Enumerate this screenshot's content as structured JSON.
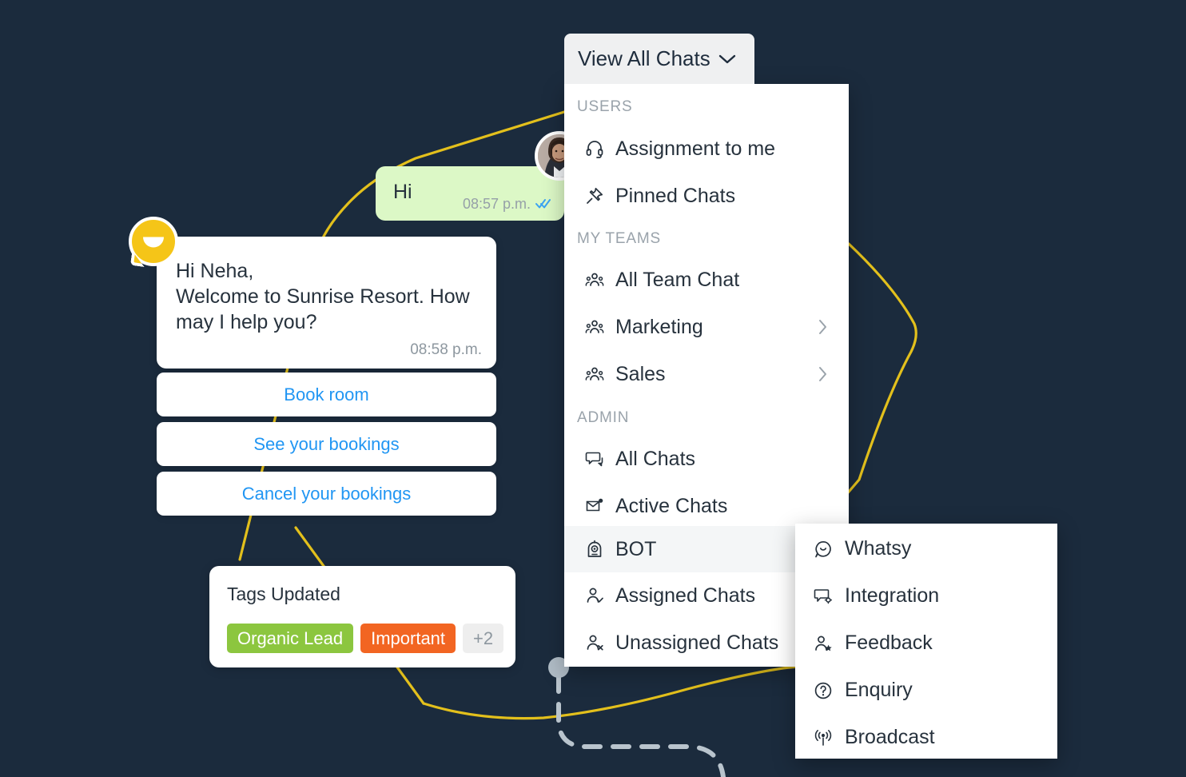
{
  "theme": {
    "background": "#1b2b3d",
    "connector_yellow": "#e3c01c",
    "connector_gray": "#b9c4cd",
    "panel_white": "#ffffff",
    "button_gray": "#eff0f1",
    "selected_row": "#f4f6f7",
    "link_blue": "#2196f3",
    "bubble_green": "#dcf8c6",
    "bot_yellow": "#f5c518",
    "tag_green": "#8cc63f",
    "tag_orange": "#f26522",
    "text_dark": "#27323d",
    "text_muted": "#9aa3ab"
  },
  "dropdown_button": {
    "label": "View All Chats",
    "icon": "chevron-down-icon"
  },
  "dropdown": {
    "groups": [
      {
        "label": "USERS",
        "items": [
          {
            "label": "Assignment to me",
            "icon": "headset-icon",
            "has_submenu": false,
            "selected": false
          },
          {
            "label": "Pinned Chats",
            "icon": "pin-icon",
            "has_submenu": false,
            "selected": false
          }
        ]
      },
      {
        "label": "MY TEAMS",
        "items": [
          {
            "label": "All Team Chat",
            "icon": "users-group-icon",
            "has_submenu": false,
            "selected": false
          },
          {
            "label": "Marketing",
            "icon": "users-group-icon",
            "has_submenu": true,
            "selected": false
          },
          {
            "label": "Sales",
            "icon": "users-group-icon",
            "has_submenu": true,
            "selected": false
          }
        ]
      },
      {
        "label": "ADMIN",
        "items": [
          {
            "label": "All Chats",
            "icon": "chat-bubbles-icon",
            "has_submenu": false,
            "selected": false
          },
          {
            "label": "Active Chats",
            "icon": "envelope-dot-icon",
            "has_submenu": false,
            "selected": false
          },
          {
            "label": "BOT",
            "icon": "robot-icon",
            "has_submenu": false,
            "selected": true
          },
          {
            "label": "Assigned Chats",
            "icon": "user-check-icon",
            "has_submenu": false,
            "selected": false
          },
          {
            "label": "Unassigned Chats",
            "icon": "user-x-icon",
            "has_submenu": false,
            "selected": false
          }
        ]
      }
    ]
  },
  "submenu": {
    "items": [
      {
        "label": "Whatsy",
        "icon": "chat-smile-icon"
      },
      {
        "label": "Integration",
        "icon": "chat-gear-icon"
      },
      {
        "label": "Feedback",
        "icon": "user-star-icon"
      },
      {
        "label": "Enquiry",
        "icon": "question-circle-icon"
      },
      {
        "label": "Broadcast",
        "icon": "broadcast-icon"
      }
    ]
  },
  "chat": {
    "incoming": {
      "text": "Hi",
      "time": "08:57 p.m.",
      "read_status_icon": "double-check-icon",
      "avatar": "user-avatar"
    },
    "bot_message": {
      "line1": "Hi Neha,",
      "line2": "Welcome to Sunrise Resort. How",
      "line3": "may I help you?",
      "time": "08:58 p.m.",
      "avatar": "bot-avatar"
    },
    "quick_replies": [
      {
        "label": "Book room"
      },
      {
        "label": "See your bookings"
      },
      {
        "label": "Cancel your bookings"
      }
    ]
  },
  "tags_card": {
    "title": "Tags Updated",
    "tags": [
      {
        "label": "Organic Lead",
        "color": "#8cc63f"
      },
      {
        "label": "Important",
        "color": "#f26522"
      }
    ],
    "overflow_label": "+2"
  }
}
